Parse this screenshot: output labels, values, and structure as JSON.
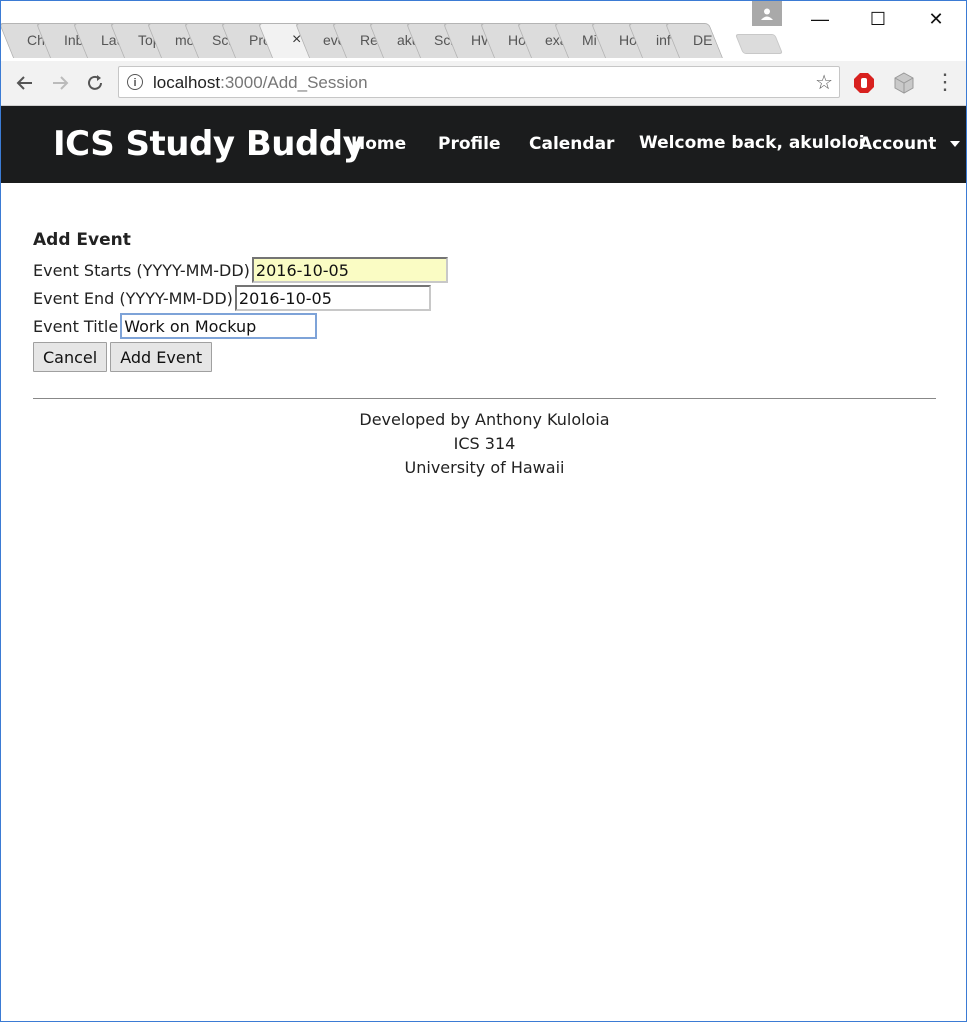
{
  "browser": {
    "tabs": [
      {
        "label": "Ch"
      },
      {
        "label": "Inb"
      },
      {
        "label": "Lau"
      },
      {
        "label": "Top"
      },
      {
        "label": "mo"
      },
      {
        "label": "Sch"
      },
      {
        "label": "Pro"
      },
      {
        "label": "×",
        "active": true
      },
      {
        "label": "eve"
      },
      {
        "label": "Re"
      },
      {
        "label": "aku"
      },
      {
        "label": "Sch"
      },
      {
        "label": "HW"
      },
      {
        "label": "Ho"
      },
      {
        "label": "exa"
      },
      {
        "label": "Mi"
      },
      {
        "label": "Ho"
      },
      {
        "label": "inf"
      },
      {
        "label": "DE"
      }
    ],
    "url_host": "localhost",
    "url_path": ":3000/Add_Session",
    "window_controls": {
      "minimize": "—",
      "maximize": "☐",
      "close": "✕"
    }
  },
  "navbar": {
    "brand": "ICS Study Buddy",
    "links": {
      "home": "Home",
      "profile": "Profile",
      "calendar": "Calendar",
      "welcome": "Welcome back, akuloloi",
      "account": "Account"
    }
  },
  "form": {
    "heading": "Add Event",
    "start_label": "Event Starts (YYYY-MM-DD)",
    "start_value": "2016-10-05",
    "end_label": "Event End (YYYY-MM-DD)",
    "end_value": "2016-10-05",
    "title_label": "Event Title",
    "title_value": "Work on Mockup",
    "cancel_label": "Cancel",
    "submit_label": "Add Event"
  },
  "footer": {
    "line1": "Developed by Anthony Kuloloia",
    "line2": "ICS 314",
    "line3": "University of Hawaii"
  },
  "colors": {
    "navbar_bg": "#1b1c1d",
    "autofill_bg": "#fafcc4"
  }
}
